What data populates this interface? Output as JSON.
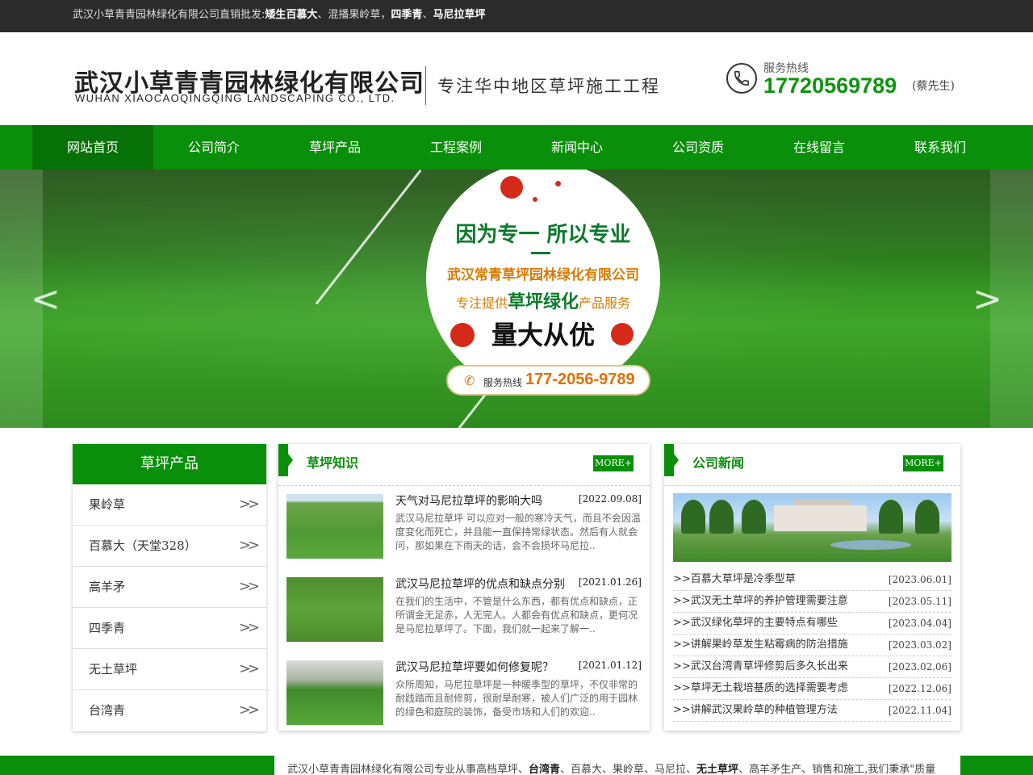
{
  "topbar": {
    "prefix": "武汉小草青青园林绿化有限公司直销批发:",
    "k1": "矮生百慕大",
    "s1": "、混播果岭草，",
    "k2": "四季青",
    "s2": "、",
    "k3": "马尼拉草坪"
  },
  "header": {
    "logo_cn": "武汉小草青青园林绿化有限公司",
    "logo_en": "WUHAN XIAOCAOQINGQING LANDSCAPING CO., LTD.",
    "slogan": "专注华中地区草坪施工工程",
    "hotline_label": "服务热线",
    "hotline_number": "17720569789",
    "hotline_name": "(蔡先生)"
  },
  "nav": [
    {
      "label": "网站首页",
      "active": true
    },
    {
      "label": "公司简介"
    },
    {
      "label": "草坪产品"
    },
    {
      "label": "工程案例"
    },
    {
      "label": "新闻中心"
    },
    {
      "label": "公司资质"
    },
    {
      "label": "在线留言"
    },
    {
      "label": "联系我们"
    }
  ],
  "banner": {
    "title": "因为专一 所以专业",
    "company": "武汉常青草坪园林绿化有限公司",
    "serve_pre": "专注提供",
    "serve_key": "草坪绿化",
    "serve_post": "产品服务",
    "big": "量大从优",
    "pill_label": "服务热线",
    "pill_number": "177-2056-9789",
    "prev": "<",
    "next": ">"
  },
  "side": {
    "title": "草坪产品",
    "items": [
      "果岭草",
      "百慕大（天堂328）",
      "高羊矛",
      "四季青",
      "无土草坪",
      "台湾青"
    ]
  },
  "knowledge": {
    "title": "草坪知识",
    "more": "MORE+",
    "items": [
      {
        "title": "天气对马尼拉草坪的影响大吗",
        "date": "[2022.09.08]",
        "desc": "武汉马尼拉草坪 可以应对一般的寒冷天气，而且不会因温度变化而死亡，并且能一直保持常绿状态。然后有人就会问，那如果在下雨天的话，会不会损坏马尼拉.."
      },
      {
        "title": "武汉马尼拉草坪的优点和缺点分别",
        "date": "[2021.01.26]",
        "desc": "在我们的生活中，不管是什么东西，都有优点和缺点，正所谓金无足赤，人无完人。人都会有优点和缺点，更何况是马尼拉草坪了。下面，我们就一起来了解一.."
      },
      {
        "title": "武汉马尼拉草坪要如何修复呢？",
        "date": "[2021.01.12]",
        "desc": "众所周知，马尼拉草坪是一种暖季型的草坪，不仅非常的耐践踏而且耐修剪，很耐旱耐寒，被人们广泛的用于园林的绿色和庭院的装饰，备受市场和人们的欢迎.."
      }
    ]
  },
  "news": {
    "title": "公司新闻",
    "more": "MORE+",
    "items": [
      {
        "title": ">>百慕大草坪是冷季型草",
        "date": "[2023.06.01]"
      },
      {
        "title": ">>武汉无土草坪的养护管理需要注意",
        "date": "[2023.05.11]"
      },
      {
        "title": ">>武汉绿化草坪的主要特点有哪些",
        "date": "[2023.04.04]"
      },
      {
        "title": ">>讲解果岭草发生粘霉病的防治措施",
        "date": "[2023.03.02]"
      },
      {
        "title": ">>武汉台湾青草坪修剪后多久长出来",
        "date": "[2023.02.06]"
      },
      {
        "title": ">>草坪无土栽培基质的选择需要考虑",
        "date": "[2022.12.06]"
      },
      {
        "title": ">>讲解武汉果岭草的种植管理方法",
        "date": "[2022.11.04]"
      }
    ]
  },
  "footer": {
    "p1": "武汉小草青青园林绿化有限公司专业从事高档草坪、",
    "k1": "台湾青",
    "p2": "、百慕大、果岭草、马尼拉、",
    "k2": "无土草坪",
    "p3": "、高羊矛生产、销售和施工,我们秉承\"质量"
  },
  "colors": {
    "brand_green": "#0a8f0a",
    "nav_active": "#067106",
    "hotline": "#109410",
    "accent_orange": "#e07000"
  }
}
